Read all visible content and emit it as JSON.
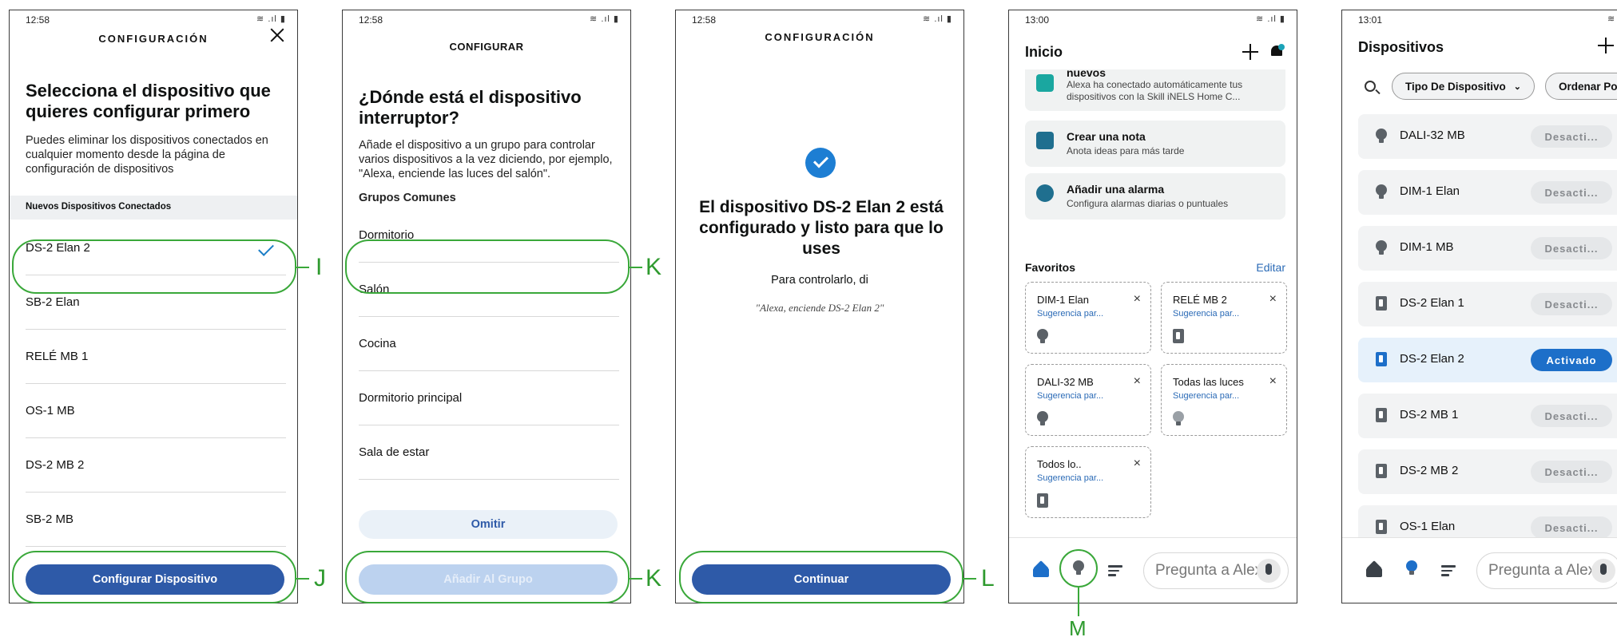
{
  "screen1": {
    "time": "12:58",
    "status_icons": "≋ .ıl ▮",
    "header": "CONFIGURACIÓN",
    "title": "Selecciona el dispositivo que quieres configurar primero",
    "description": "Puedes eliminar los dispositivos conectados en cualquier momento desde la página de configuración de dispositivos",
    "section": "Nuevos Dispositivos Conectados",
    "devices": [
      "DS-2 Elan 2",
      "SB-2 Elan",
      "RELÉ MB 1",
      "OS-1 MB",
      "DS-2 MB 2",
      "SB-2 MB"
    ],
    "selected_device": "DS-2 Elan 2",
    "button": "Configurar Dispositivo"
  },
  "screen2": {
    "time": "12:58",
    "status_icons": "≋ .ıl ▮",
    "header": "CONFIGURAR",
    "title": "¿Dónde está el dispositivo interruptor?",
    "description": "Añade el dispositivo a un grupo para controlar varios dispositivos a la vez diciendo, por ejemplo, \"Alexa, enciende las luces del salón\".",
    "section": "Grupos Comunes",
    "groups": [
      "Dormitorio",
      "Salón",
      "Cocina",
      "Dormitorio principal",
      "Sala de estar"
    ],
    "skip_button": "Omitir",
    "add_button": "Añadir Al Grupo"
  },
  "screen3": {
    "time": "12:58",
    "status_icons": "≋ .ıl ▮",
    "header": "CONFIGURACIÓN",
    "title": "El dispositivo DS-2 Elan 2 está configurado y listo para que lo uses",
    "subtitle": "Para controlarlo, di",
    "example": "\"Alexa, enciende DS-2 Elan 2\"",
    "button": "Continuar"
  },
  "screen4": {
    "time": "13:00",
    "status_icons": "≋ .ıl ▮",
    "title": "Inicio",
    "cards": [
      {
        "title": "nuevos",
        "subtitle": "Alexa ha conectado automáticamente tus dispositivos con la Skill iNELS Home C..."
      },
      {
        "title": "Crear una nota",
        "subtitle": "Anota ideas para más tarde"
      },
      {
        "title": "Añadir una alarma",
        "subtitle": "Configura alarmas diarias o puntuales"
      }
    ],
    "favorites_label": "Favoritos",
    "edit_label": "Editar",
    "favorites": [
      {
        "name": "DIM-1 Elan",
        "hint": "Sugerencia par...",
        "icon": "bulb-icon"
      },
      {
        "name": "RELÉ MB 2",
        "hint": "Sugerencia par...",
        "icon": "switch-icon"
      },
      {
        "name": "DALI-32 MB",
        "hint": "Sugerencia par...",
        "icon": "bulb-icon"
      },
      {
        "name": "Todas las luces",
        "hint": "Sugerencia par...",
        "icon": "bulbs-icon"
      },
      {
        "name": "Todos lo..",
        "hint": "Sugerencia par...",
        "icon": "switches-icon"
      }
    ],
    "ask_placeholder": "Pregunta a Alexa"
  },
  "screen5": {
    "time": "13:01",
    "status_icons": "≋ .ıl ▮",
    "title": "Dispositivos",
    "chip_type": "Tipo De Dispositivo",
    "chip_order": "Ordenar Por",
    "devices": [
      {
        "name": "DALI-32 MB",
        "state": "Desacti...",
        "icon": "bulb-icon",
        "active": false
      },
      {
        "name": "DIM-1 Elan",
        "state": "Desacti...",
        "icon": "bulb-icon",
        "active": false
      },
      {
        "name": "DIM-1 MB",
        "state": "Desacti...",
        "icon": "bulb-icon",
        "active": false
      },
      {
        "name": "DS-2 Elan 1",
        "state": "Desacti...",
        "icon": "switch-icon",
        "active": false
      },
      {
        "name": "DS-2 Elan 2",
        "state": "Activado",
        "icon": "switch-icon",
        "active": true
      },
      {
        "name": "DS-2 MB 1",
        "state": "Desacti...",
        "icon": "switch-icon",
        "active": false
      },
      {
        "name": "DS-2 MB 2",
        "state": "Desacti...",
        "icon": "switch-icon",
        "active": false
      },
      {
        "name": "OS-1 Elan",
        "state": "Desacti...",
        "icon": "switch-icon",
        "active": false
      }
    ],
    "ask_placeholder": "Pregunta a Alexa"
  },
  "annotations": {
    "I": "I",
    "J": "J",
    "K1": "K",
    "K2": "K",
    "L": "L",
    "M": "M"
  },
  "colors": {
    "accent": "#2e5aa8",
    "annotation": "#3aa83a",
    "active": "#1d6fc9"
  }
}
